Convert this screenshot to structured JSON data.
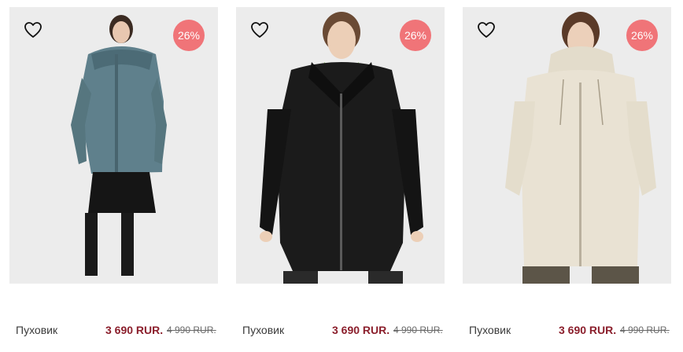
{
  "products": [
    {
      "name": "Пуховик",
      "price": "3 690 RUR.",
      "old_price": "4 990 RUR.",
      "discount": "26%",
      "coat_color": "#5f808c",
      "favorite_icon": "heart-outline-icon"
    },
    {
      "name": "Пуховик",
      "price": "3 690 RUR.",
      "old_price": "4 990 RUR.",
      "discount": "26%",
      "coat_color": "#1b1b1b",
      "favorite_icon": "heart-outline-icon"
    },
    {
      "name": "Пуховик",
      "price": "3 690 RUR.",
      "old_price": "4 990 RUR.",
      "discount": "26%",
      "coat_color": "#e9e2d3",
      "favorite_icon": "heart-outline-icon"
    }
  ],
  "colors": {
    "badge": "#f07478",
    "price": "#8b1f2c",
    "photo_background": "#ececec"
  }
}
